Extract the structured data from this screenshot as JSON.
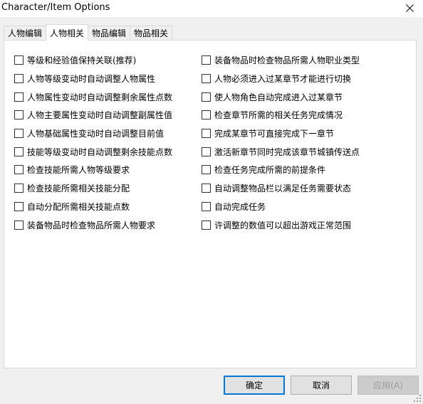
{
  "window": {
    "title": "Character/Item Options"
  },
  "tabs": [
    {
      "label": "人物编辑"
    },
    {
      "label": "人物相关"
    },
    {
      "label": "物品编辑"
    },
    {
      "label": "物品相关"
    }
  ],
  "active_tab": "人物相关",
  "options_left": [
    {
      "label": "等级和经验值保持关联(推荐)",
      "checked": false
    },
    {
      "label": "人物等级变动时自动调整人物属性",
      "checked": false
    },
    {
      "label": "人物属性变动时自动调整剩余属性点数",
      "checked": false
    },
    {
      "label": "人物主要属性变动时自动调整副属性值",
      "checked": false
    },
    {
      "label": "人物基础属性变动时自动调整目前值",
      "checked": false
    },
    {
      "label": "技能等级变动时自动调整剩余技能点数",
      "checked": false
    },
    {
      "label": "检查技能所需人物等级要求",
      "checked": false
    },
    {
      "label": "检查技能所需相关技能分配",
      "checked": false
    },
    {
      "label": "自动分配所需相关技能点数",
      "checked": false
    },
    {
      "label": "装备物品时检查物品所需人物要求",
      "checked": false
    }
  ],
  "options_right": [
    {
      "label": "装备物品时检查物品所需人物职业类型",
      "checked": false
    },
    {
      "label": "人物必须进入过某章节才能进行切换",
      "checked": false
    },
    {
      "label": "使人物角色自动完成进入过某章节",
      "checked": false
    },
    {
      "label": "检查章节所需的相关任务完成情况",
      "checked": false
    },
    {
      "label": "完成某章节可直接完成下一章节",
      "checked": false
    },
    {
      "label": "激活新章节同时完成该章节城镇传送点",
      "checked": false
    },
    {
      "label": "检查任务完成所需的前提条件",
      "checked": false
    },
    {
      "label": "自动调整物品栏以满足任务需要状态",
      "checked": false
    },
    {
      "label": "自动完成任务",
      "checked": false
    },
    {
      "label": "许调整的数值可以超出游戏正常范围",
      "checked": false
    }
  ],
  "buttons": {
    "ok": "确定",
    "cancel": "取消",
    "apply": "应用(A)"
  },
  "colors": {
    "dialog_bg": "#f0f0f0",
    "panel_bg": "#ffffff",
    "default_button_border": "#0078d7"
  }
}
